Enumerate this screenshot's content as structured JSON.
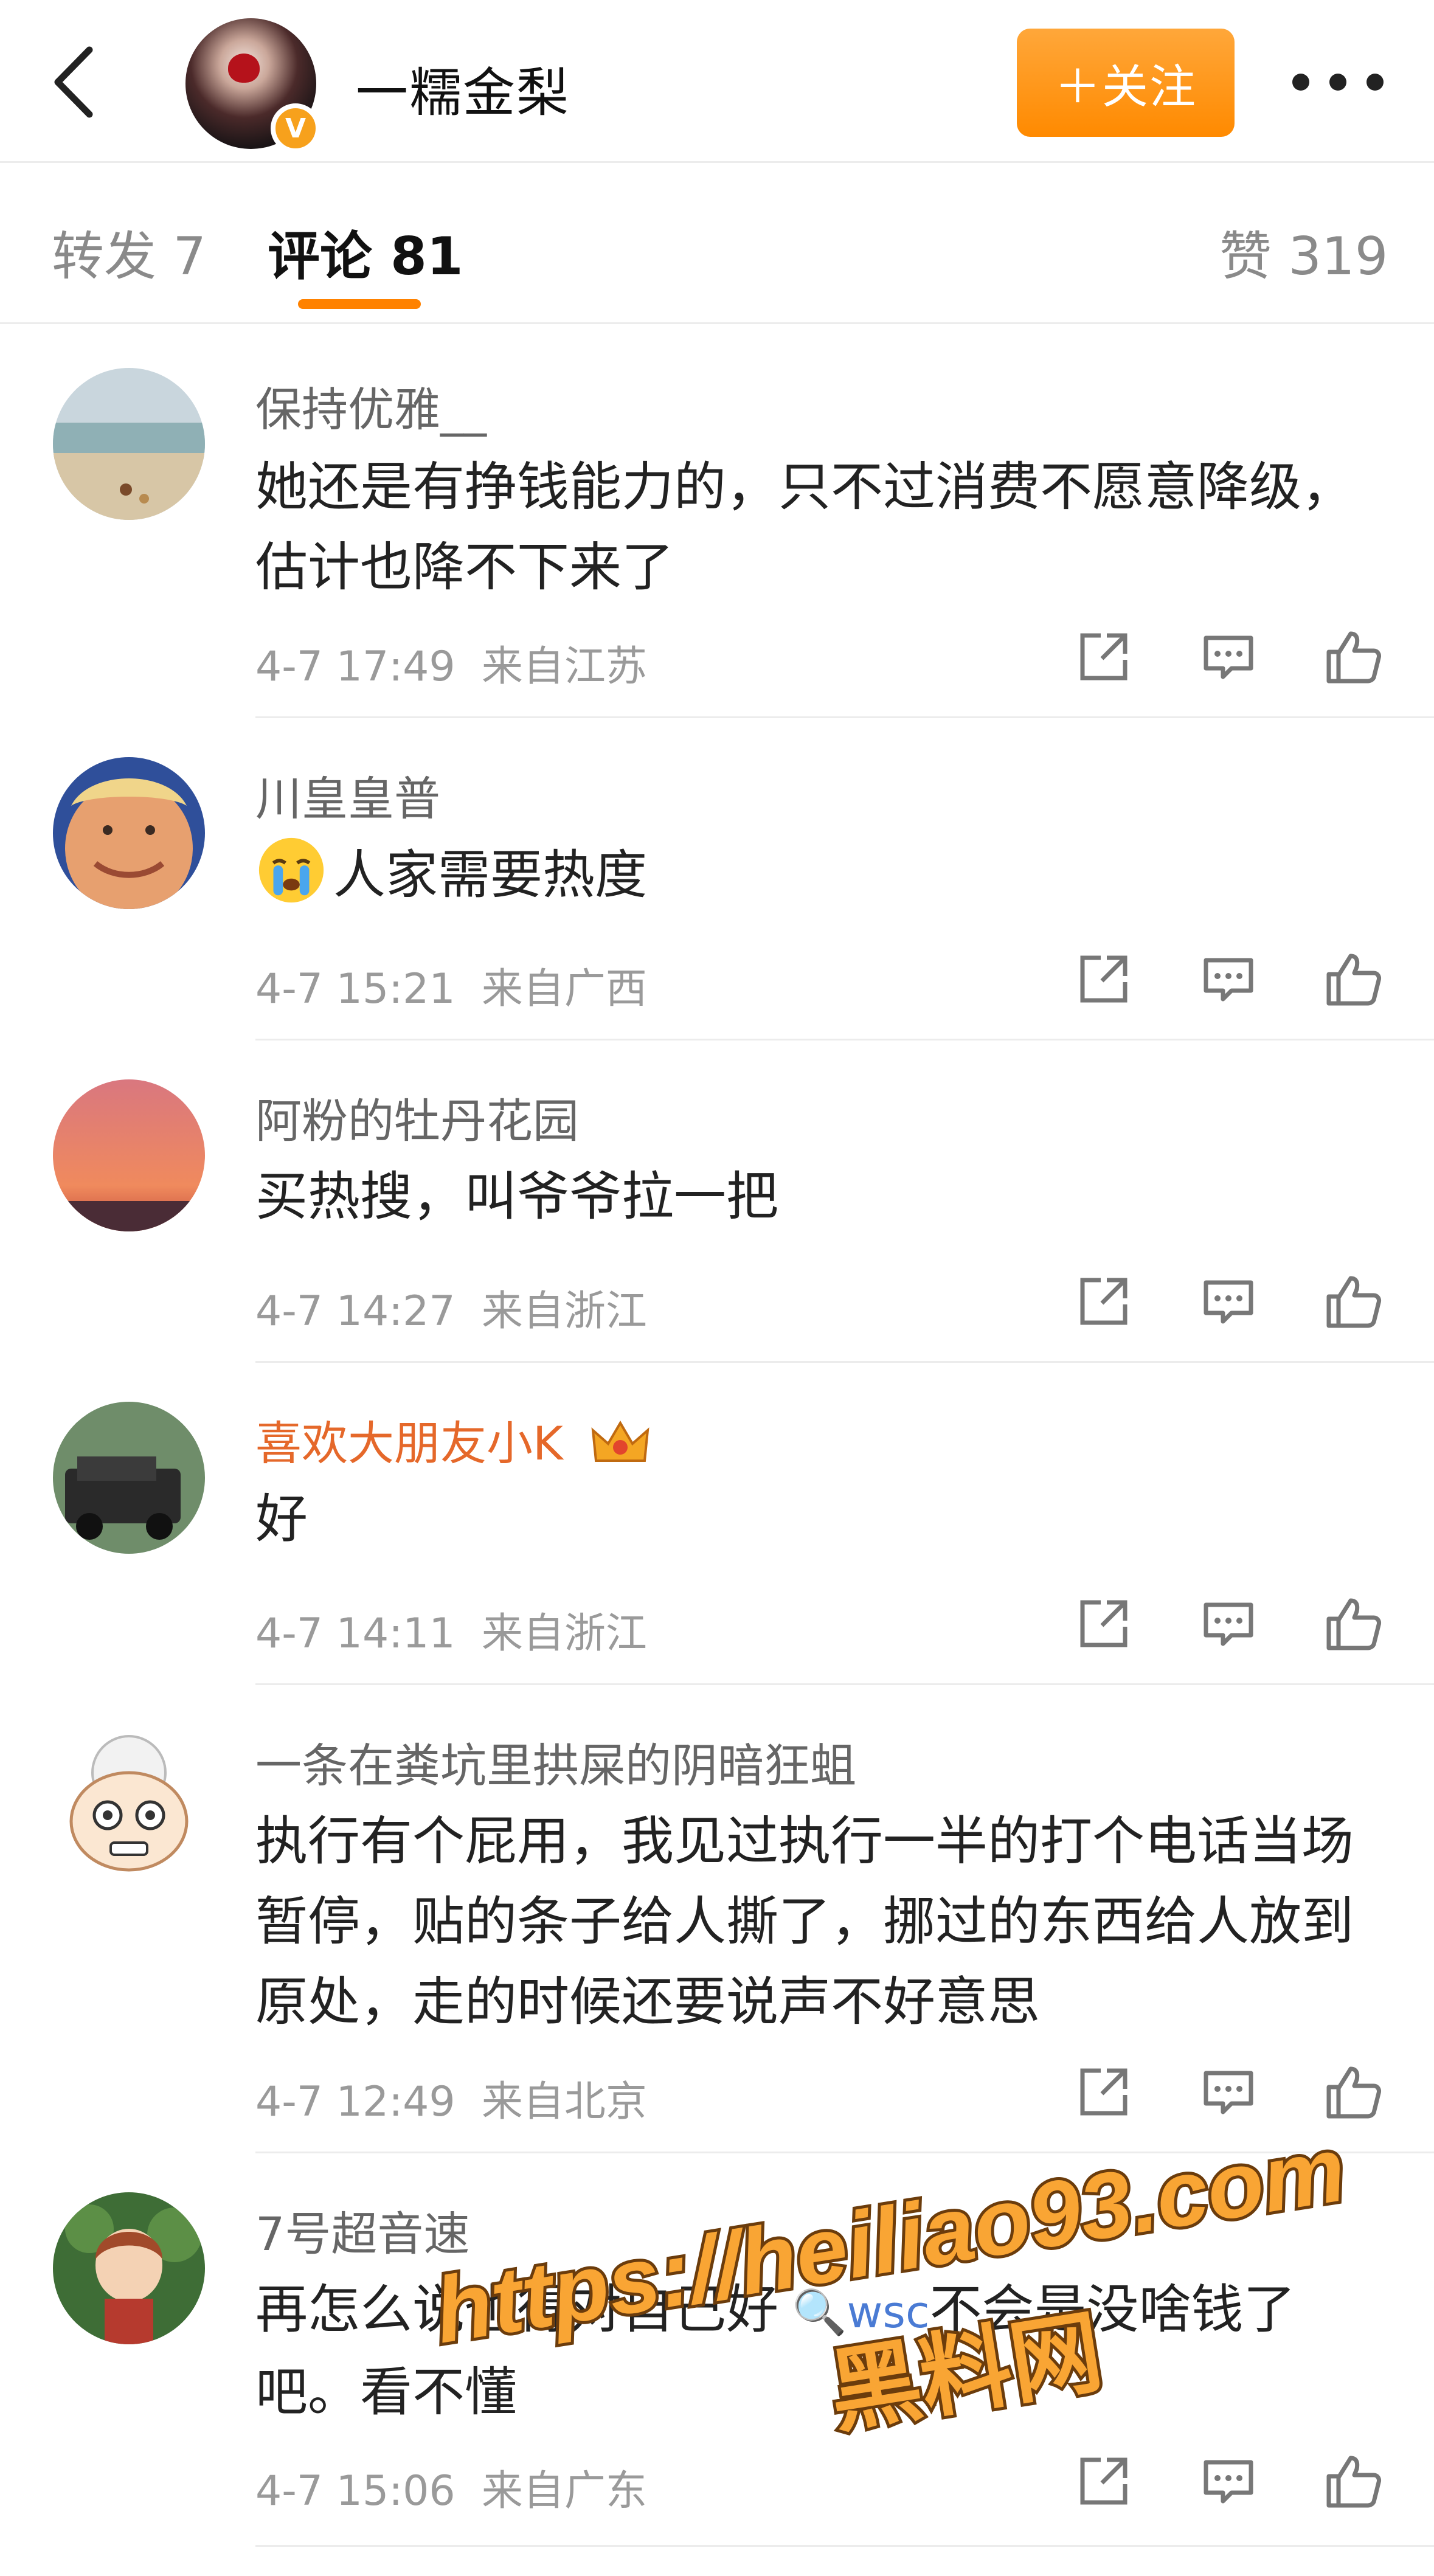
{
  "header": {
    "back_icon": "chevron-left-icon",
    "author_name": "一糯金梨",
    "verified_badge": "V",
    "follow_label": "＋关注",
    "more_icon": "more-dots-icon"
  },
  "tabs": [
    {
      "label": "转发 7",
      "active": false
    },
    {
      "label": "评论 81",
      "active": true
    },
    {
      "label": "赞 319",
      "active": false
    }
  ],
  "accent_color": "#ff8200",
  "comments": [
    {
      "user": "保持优雅__",
      "text": "她还是有挣钱能力的，只不过消费不愿意降级，估计也降不下来了",
      "time": "4-7 17:49",
      "location": "来自江苏"
    },
    {
      "user": "川皇皇普",
      "emoji": "crying-face-icon",
      "text": "人家需要热度",
      "time": "4-7 15:21",
      "location": "来自广西"
    },
    {
      "user": "阿粉的牡丹花园",
      "text": "买热搜，叫爷爷拉一把",
      "time": "4-7 14:27",
      "location": "来自浙江"
    },
    {
      "user": "喜欢大朋友小K",
      "badge_icon": "crown-icon",
      "text": "好",
      "time": "4-7 14:11",
      "location": "来自浙江"
    },
    {
      "user": "一条在粪坑里拱屎的阴暗狂蛆",
      "text": "执行有个屁用，我见过执行一半的打个电话当场暂停，贴的条子给人撕了，挪过的东西给人放到原处，走的时候还要说声不好意思",
      "time": "4-7 12:49",
      "location": "来自北京"
    },
    {
      "user": "7号超音速",
      "text_before": "再怎么说也得对自己好",
      "link": "wsc",
      "text_after": "不会是没啥钱了吧。看不懂",
      "time": "4-7 15:06",
      "location": "来自广东"
    }
  ],
  "actions": {
    "share_icon": "share-icon",
    "comment_icon": "comment-icon",
    "like_icon": "thumbs-up-icon"
  },
  "watermark": {
    "url": "https://heiliao93.com",
    "cn": "黑料网"
  }
}
